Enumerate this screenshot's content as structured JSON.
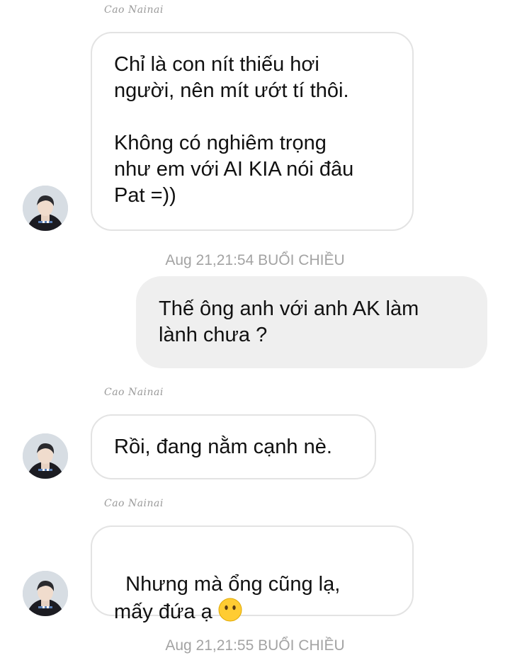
{
  "conversation": {
    "messages": [
      {
        "sender": "Cao Nainai",
        "text": "Chỉ là con nít thiếu hơi\nngười, nên mít ướt tí thôi.\n\nKhông có nghiêm trọng\nnhư em với AI KIA nói đâu\nPat =))"
      },
      {
        "timestamp": "Aug 21,21:54 BUỔI CHIỀU"
      },
      {
        "text": "Thế ông anh với anh AK làm\nlành chưa ?"
      },
      {
        "sender": "Cao Nainai",
        "text": "Rồi, đang nằm cạnh nè."
      },
      {
        "sender": "Cao Nainai",
        "text": "Nhưng mà ổng cũng lạ,\nmấy đứa ạ ",
        "emoji": "neutral-face-no-mouth"
      },
      {
        "timestamp": "Aug 21,21:55 BUỔI CHIỀU"
      }
    ]
  },
  "colors": {
    "incoming_border": "#e3e3e3",
    "outgoing_bg": "#efefef",
    "timestamp": "#a3a3a3",
    "sender": "#9a9a9a",
    "emoji": "#ffcc33"
  }
}
